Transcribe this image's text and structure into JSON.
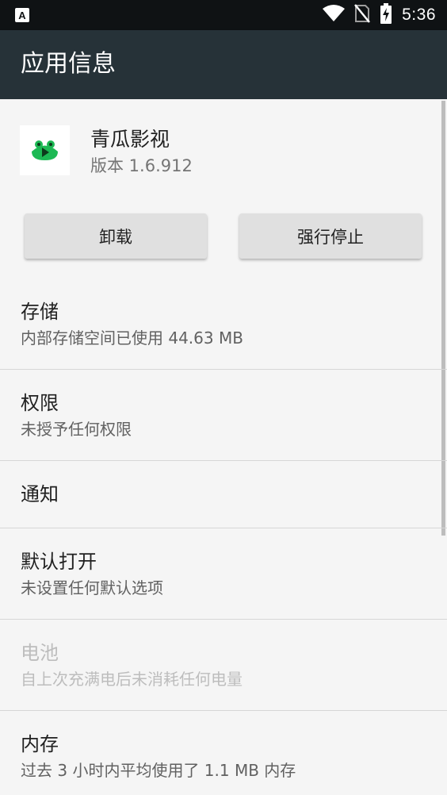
{
  "status_bar": {
    "time": "5:36",
    "icons": [
      "notification-a-icon",
      "wifi-icon",
      "no-sim-icon",
      "battery-charging-icon"
    ]
  },
  "app_bar": {
    "title": "应用信息"
  },
  "app": {
    "name": "青瓜影视",
    "version": "版本 1.6.912",
    "icon": "qinggua-app-icon",
    "icon_color": "#1db954"
  },
  "buttons": {
    "uninstall": "卸载",
    "force_stop": "强行停止"
  },
  "items": [
    {
      "title": "存储",
      "summary": "内部存储空间已使用 44.63 MB",
      "enabled": true
    },
    {
      "title": "权限",
      "summary": "未授予任何权限",
      "enabled": true
    },
    {
      "title": "通知",
      "summary": "",
      "enabled": true
    },
    {
      "title": "默认打开",
      "summary": "未设置任何默认选项",
      "enabled": true
    },
    {
      "title": "电池",
      "summary": "自上次充满电后未消耗任何电量",
      "enabled": false
    },
    {
      "title": "内存",
      "summary": "过去 3 小时内平均使用了 1.1 MB 内存",
      "enabled": true
    }
  ],
  "colors": {
    "app_bar": "#263238",
    "status_bar": "#0f1214",
    "background": "#f5f5f5",
    "button": "#e0e0e0"
  }
}
